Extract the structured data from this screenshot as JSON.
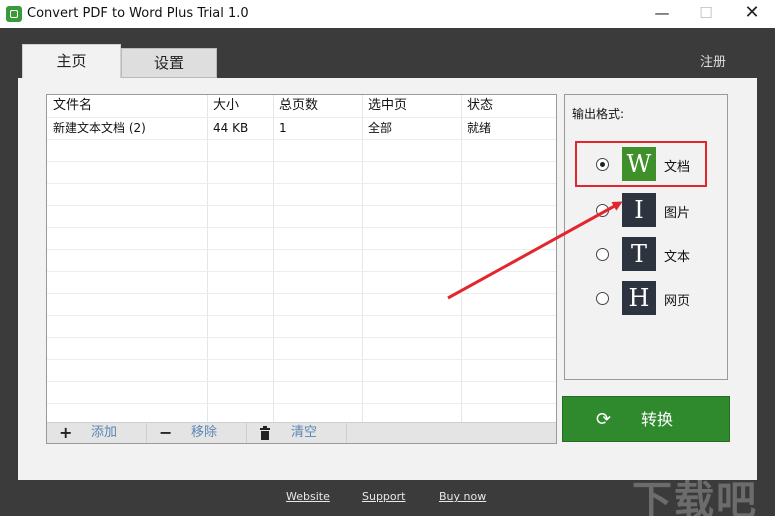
{
  "window": {
    "title": "Convert PDF to Word Plus Trial 1.0",
    "controls": {
      "minimize": "—",
      "maximize": "☐",
      "close": "✕"
    }
  },
  "tabs": [
    {
      "label": "主页",
      "active": true
    },
    {
      "label": "设置",
      "active": false
    }
  ],
  "register_label": "注册",
  "file_table": {
    "columns": [
      "文件名",
      "大小",
      "总页数",
      "选中页",
      "状态"
    ],
    "rows": [
      [
        "新建文本文档 (2)",
        "44 KB",
        "1",
        "全部",
        "就绪"
      ]
    ]
  },
  "toolbar": {
    "add": "添加",
    "remove": "移除",
    "clear": "清空"
  },
  "output_format": {
    "title": "输出格式:",
    "options": [
      {
        "letter": "W",
        "label": "文档",
        "selected": true,
        "color": "#3f8f2a",
        "highlighted": true
      },
      {
        "letter": "I",
        "label": "图片",
        "selected": false,
        "color": "#2d3440"
      },
      {
        "letter": "T",
        "label": "文本",
        "selected": false,
        "color": "#2d3440"
      },
      {
        "letter": "H",
        "label": "网页",
        "selected": false,
        "color": "#2d3440"
      }
    ]
  },
  "convert_label": "转换",
  "footer_links": [
    "Website",
    "Support",
    "Buy now"
  ],
  "watermark": "下载吧",
  "colors": {
    "accent_green": "#2f8a2d",
    "annotation_red": "#e3262d",
    "link_blue": "#5b86b5"
  }
}
